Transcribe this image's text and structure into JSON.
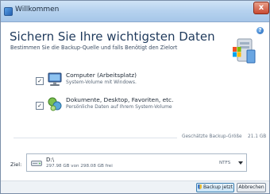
{
  "window": {
    "title": "Willkommen",
    "close_glyph": "x"
  },
  "header": {
    "title": "Sichern Sie Ihre wichtigsten Daten",
    "subtitle": "Bestimmen Sie die Backup-Quelle und falls Benötigt den Zielort",
    "help_glyph": "?"
  },
  "sources": [
    {
      "checked": true,
      "title": "Computer (Arbeitsplatz)",
      "description": "System-Volume mit Windows.",
      "icon": "computer-icon"
    },
    {
      "checked": true,
      "title": "Dokumente, Desktop, Favoriten, etc.",
      "description": "Persönliche Daten auf Ihrem System-Volume",
      "icon": "user-data-icon"
    }
  ],
  "check_glyph": "✓",
  "backup_size": {
    "label": "Geschätzte Backup-Größe",
    "value": "21.1 GB"
  },
  "target": {
    "label": "Ziel:",
    "drive": "D:\\",
    "free_space": "297.98 GB von 298.08 GB frei",
    "filesystem": "NTFS"
  },
  "footer": {
    "backup_button": "Backup jetzt",
    "cancel_button": "Abbrechen"
  },
  "colors": {
    "accent": "#1f3a5c",
    "titlebar": "#b7d3ef",
    "footer": "#eef2f6"
  }
}
